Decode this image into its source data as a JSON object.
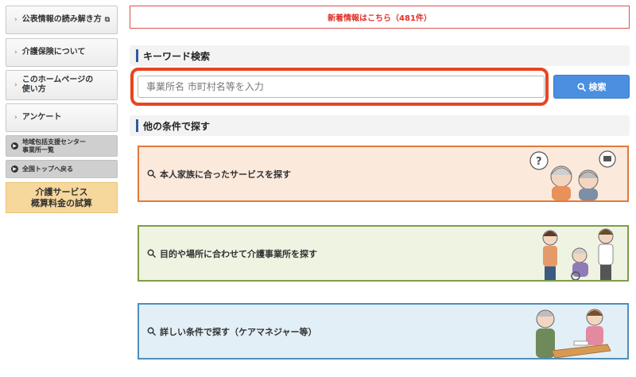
{
  "sidebar": {
    "items": [
      {
        "label": "公表情報の読み解き方",
        "external": "⧉"
      },
      {
        "label": "介護保険について"
      },
      {
        "label_line1": "このホームページの",
        "label_line2": "使い方"
      },
      {
        "label": "アンケート"
      }
    ],
    "gray_links": [
      {
        "label_line1": "地域包括支援センター",
        "label_line2": "事業所一覧"
      },
      {
        "label": "全国トップへ戻る"
      }
    ],
    "calc": {
      "line1": "介護サービス",
      "line2": "概算料金の試算"
    }
  },
  "news": {
    "label": "新着情報はこちら（481件）"
  },
  "keyword": {
    "heading": "キーワード検索",
    "placeholder": "事業所名 市町村名等を入力",
    "button_label": "検索"
  },
  "other": {
    "heading": "他の条件で探す"
  },
  "cards": [
    {
      "label": "本人家族に合ったサービスを探す",
      "border": "#e07a3a",
      "bg": "#fbe9dc"
    },
    {
      "label": "目的や場所に合わせて介護事業所を探す",
      "border": "#7f9c4a",
      "bg": "#eef3e2"
    },
    {
      "label": "詳しい条件で探す（ケアマネジャー等）",
      "border": "#4d8fb8",
      "bg": "#e2eff7"
    }
  ],
  "colors": {
    "accent_red": "#e8451f",
    "button_blue": "#4a8fe0",
    "heading_bar": "#2f5d9e"
  }
}
